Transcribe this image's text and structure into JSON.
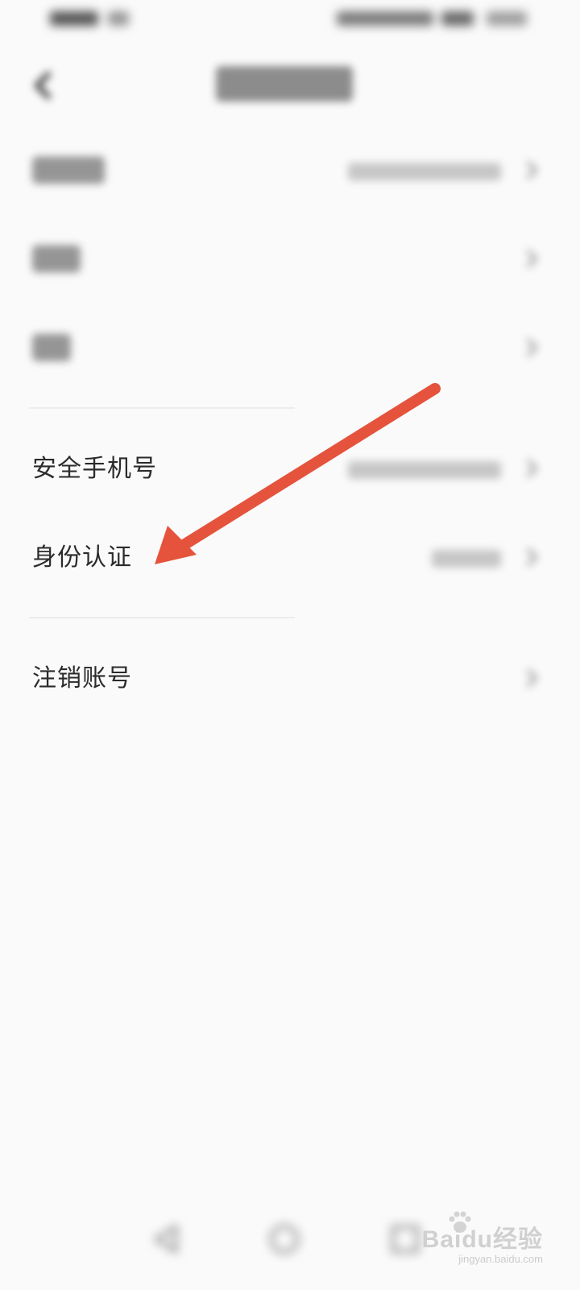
{
  "rows": {
    "secure_phone": {
      "label": "安全手机号"
    },
    "identity": {
      "label": "身份认证"
    },
    "cancel_account": {
      "label": "注销账号"
    }
  },
  "annotation": {
    "arrow_color": "#e5533d"
  },
  "watermark": {
    "logo_text": "Baidu经验",
    "url": "jingyan.baidu.com"
  },
  "colors": {
    "background": "#fafafa",
    "text": "#2b2b2b",
    "chevron": "#bdbdbd"
  }
}
